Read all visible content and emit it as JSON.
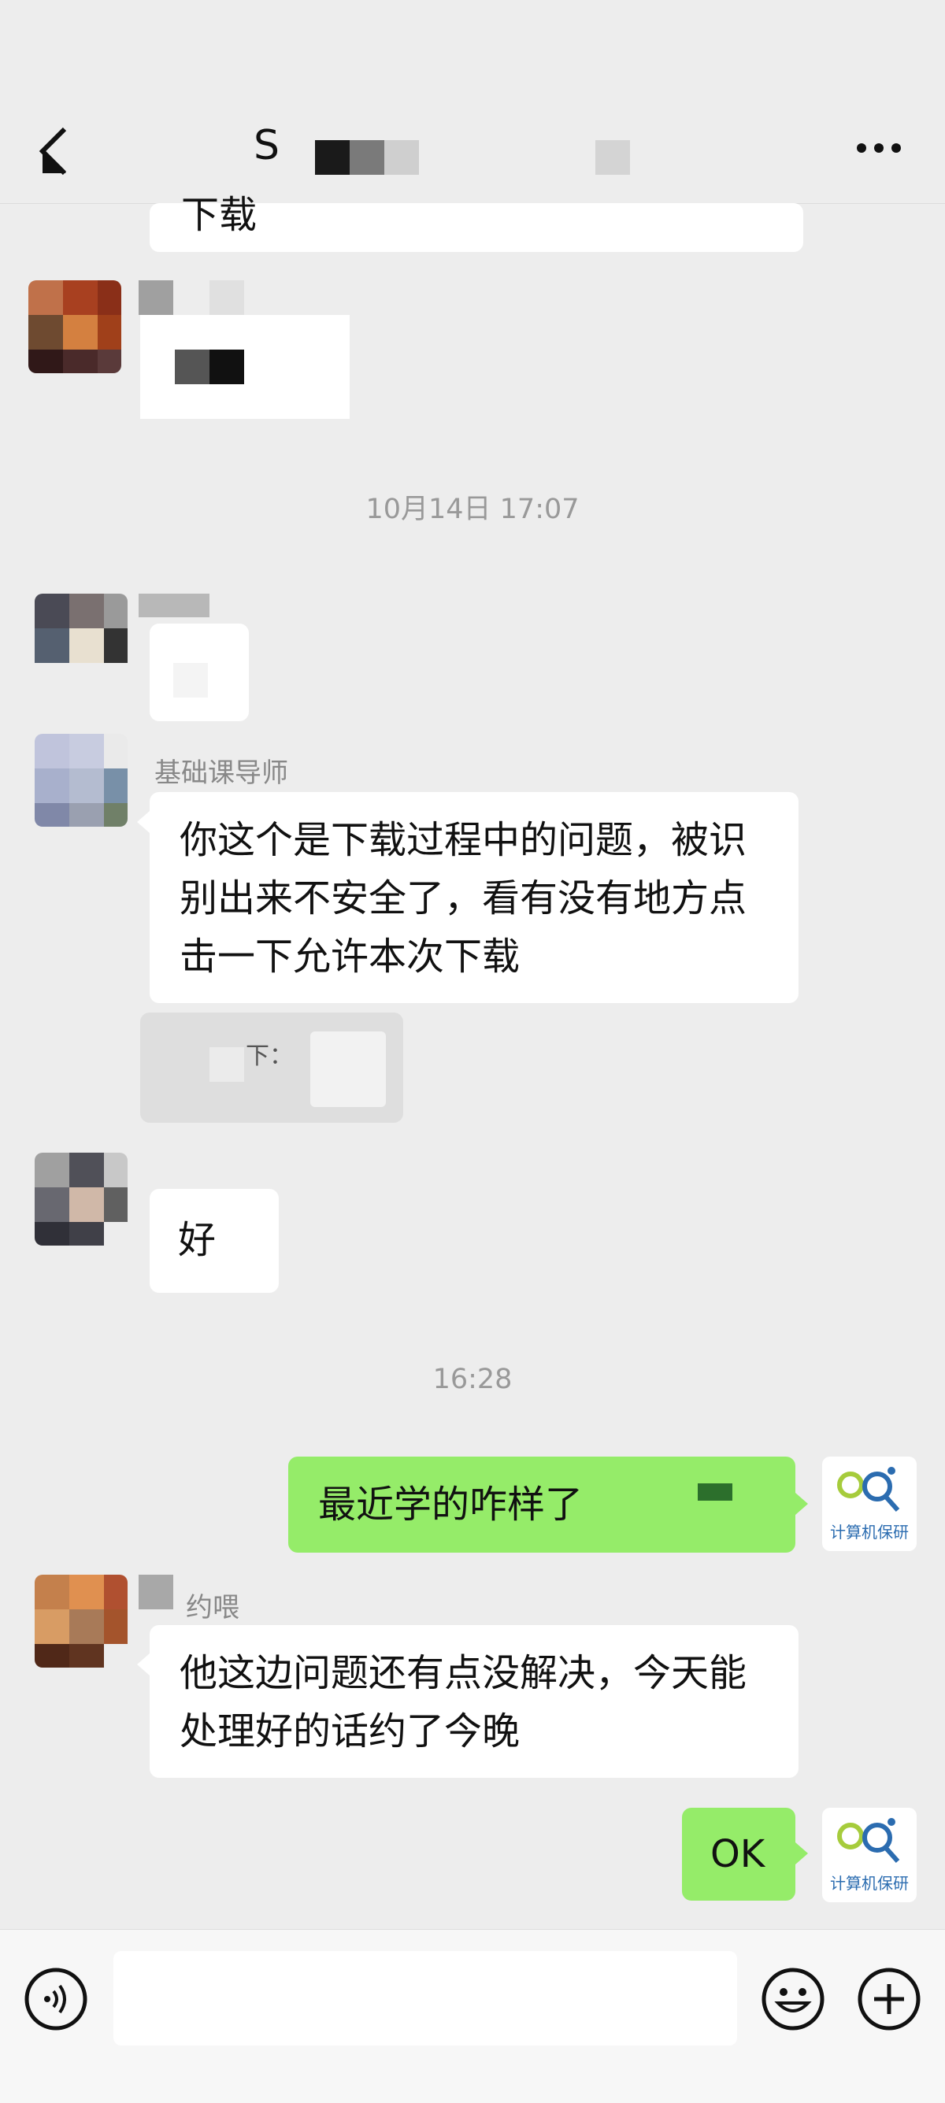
{
  "header": {
    "title": "S",
    "back_icon": "back-arrow-icon",
    "more_icon": "more-dots-icon"
  },
  "messages": {
    "partial_top": "下载",
    "timestamp_1": "10月14日 17:07",
    "nick_teacher": "基础课导师",
    "msg_teacher": "你这个是下载过程中的问题，被识别出来不安全了，看有没有地方点击一下允许本次下载",
    "msg_fuzzy_small": "下：",
    "msg_ok_reply": "好",
    "timestamp_2": "16:28",
    "msg_me_1": "最近学的咋样了",
    "nick_yue": "约喂",
    "msg_yue": "他这边问题还有点没解决，今天能处理好的话约了今晚",
    "msg_me_2": "OK",
    "logo_text": "计算机保研"
  },
  "colors": {
    "background": "#ededed",
    "bubble_green": "#95ec69",
    "bubble_white": "#ffffff"
  },
  "bottom": {
    "voice_icon": "voice-icon",
    "emoji_icon": "emoji-icon",
    "plus_icon": "plus-icon"
  }
}
